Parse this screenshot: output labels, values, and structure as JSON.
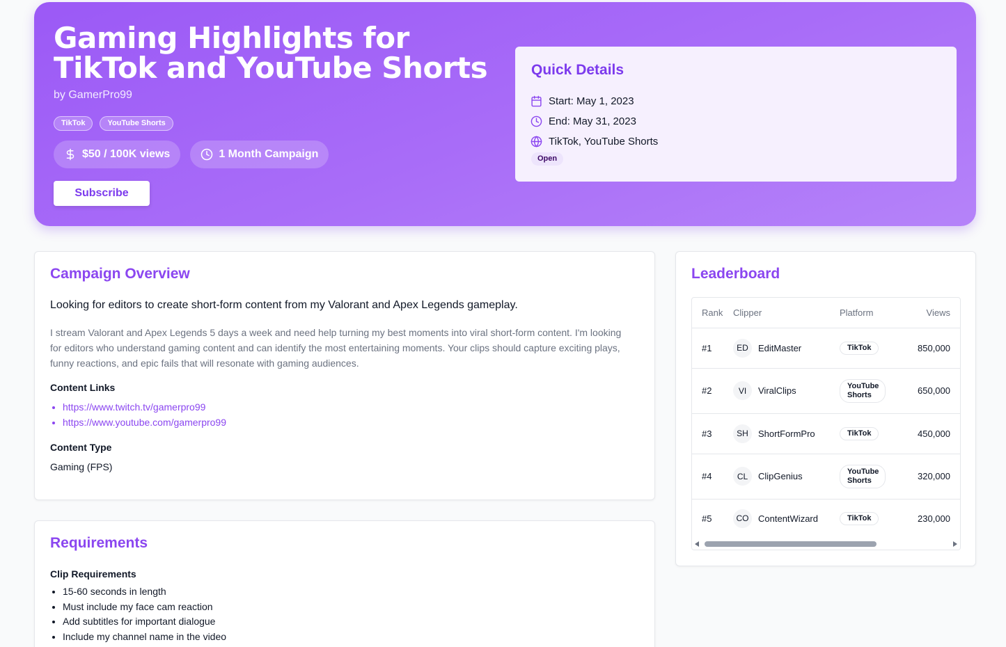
{
  "hero": {
    "title": "Gaming Highlights for TikTok and YouTube Shorts",
    "author": "by GamerPro99",
    "tags": [
      "TikTok",
      "YouTube Shorts"
    ],
    "rate": "$50 / 100K views",
    "duration": "1 Month Campaign",
    "subscribe_label": "Subscribe",
    "icons": {
      "rate": "dollar-icon",
      "duration": "clock-icon"
    }
  },
  "quick_details": {
    "title": "Quick Details",
    "start": "Start: May 1, 2023",
    "end": "End: May 31, 2023",
    "platforms": "TikTok, YouTube Shorts",
    "status": "Open",
    "icons": {
      "start": "calendar-icon",
      "end": "clock-icon",
      "platforms": "globe-icon"
    }
  },
  "overview": {
    "title": "Campaign Overview",
    "lead": "Looking for editors to create short-form content from my Valorant and Apex Legends gameplay.",
    "description": "I stream Valorant and Apex Legends 5 days a week and need help turning my best moments into viral short-form content. I'm looking for editors who understand gaming content and can identify the most entertaining moments. Your clips should capture exciting plays, funny reactions, and epic fails that will resonate with gaming audiences.",
    "links_heading": "Content Links",
    "links": [
      "https://www.twitch.tv/gamerpro99",
      "https://www.youtube.com/gamerpro99"
    ],
    "type_heading": "Content Type",
    "type_value": "Gaming (FPS)"
  },
  "requirements": {
    "title": "Requirements",
    "clip_heading": "Clip Requirements",
    "items": [
      "15-60 seconds in length",
      "Must include my face cam reaction",
      "Add subtitles for important dialogue",
      "Include my channel name in the video"
    ]
  },
  "leaderboard": {
    "title": "Leaderboard",
    "columns": [
      "Rank",
      "Clipper",
      "Platform",
      "Views"
    ],
    "rows": [
      {
        "rank": "#1",
        "initials": "ED",
        "name": "EditMaster",
        "platform": "TikTok",
        "views": "850,000"
      },
      {
        "rank": "#2",
        "initials": "VI",
        "name": "ViralClips",
        "platform": "YouTube Shorts",
        "views": "650,000"
      },
      {
        "rank": "#3",
        "initials": "SH",
        "name": "ShortFormPro",
        "platform": "TikTok",
        "views": "450,000"
      },
      {
        "rank": "#4",
        "initials": "CL",
        "name": "ClipGenius",
        "platform": "YouTube Shorts",
        "views": "320,000"
      },
      {
        "rank": "#5",
        "initials": "CO",
        "name": "ContentWizard",
        "platform": "TikTok",
        "views": "230,000"
      }
    ]
  },
  "colors": {
    "accent": "#8b46f0",
    "hero_start": "#9b59f6",
    "hero_end": "#b583f9"
  }
}
